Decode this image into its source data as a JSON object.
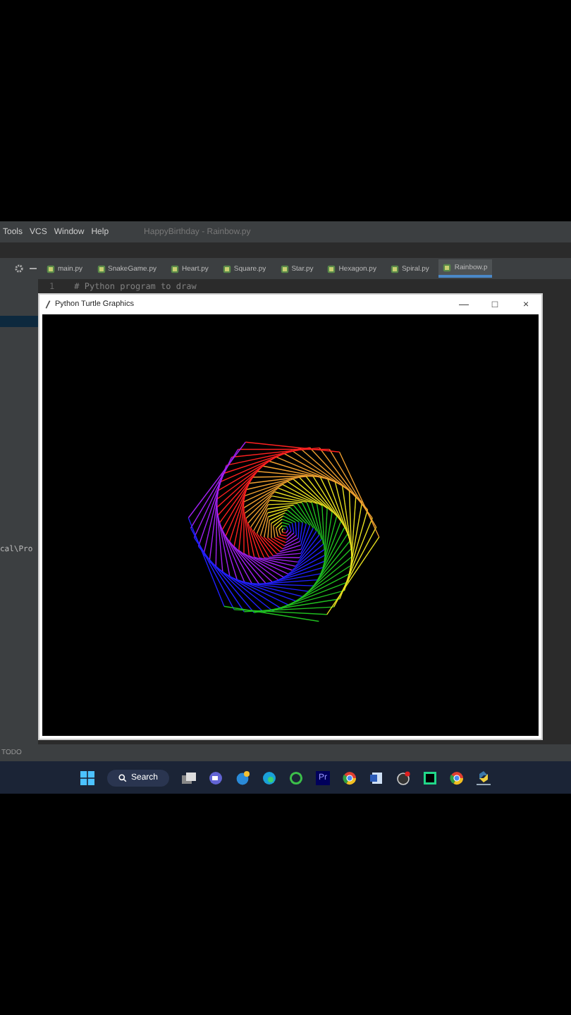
{
  "menu": [
    "Tools",
    "VCS",
    "Window",
    "Help"
  ],
  "project_title": "HappyBirthday - Rainbow.py",
  "editor_tabs": [
    {
      "label": "main.py",
      "selected": false
    },
    {
      "label": "SnakeGame.py",
      "selected": false
    },
    {
      "label": "Heart.py",
      "selected": false
    },
    {
      "label": "Square.py",
      "selected": false
    },
    {
      "label": "Star.py",
      "selected": false
    },
    {
      "label": "Hexagon.py",
      "selected": false
    },
    {
      "label": "Spiral.py",
      "selected": false
    },
    {
      "label": "Rainbow.p",
      "selected": true
    }
  ],
  "code_lines": [
    {
      "number": "1",
      "text": "# Python program to draw"
    }
  ],
  "run_output_fragment": "cal\\Pro",
  "bottom_tool_tabs": [
    "TODO"
  ],
  "turtle_window": {
    "title": "Python Turtle Graphics",
    "controls": [
      "—",
      "□",
      "×"
    ]
  },
  "taskbar": {
    "search": "Search",
    "premiere_label": "Pr"
  }
}
